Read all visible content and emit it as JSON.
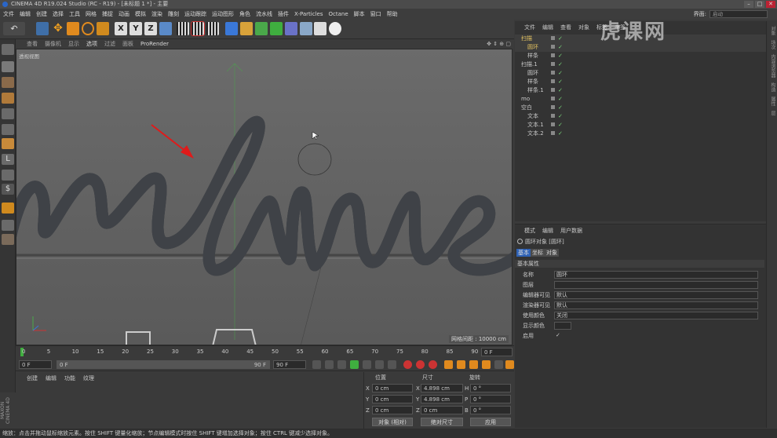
{
  "app": {
    "title": "CINEMA 4D R19.024 Studio (RC - R19) - [未标题 1 *] - 主要"
  },
  "menubar": {
    "items": [
      "文件",
      "编辑",
      "创建",
      "选择",
      "工具",
      "网格",
      "捕捉",
      "动画",
      "模拟",
      "渲染",
      "雕刻",
      "运动跟踪",
      "运动图形",
      "角色",
      "流水线",
      "插件",
      "X-Particles",
      "Octane",
      "脚本",
      "窗口",
      "帮助"
    ],
    "layout_label": "界面:",
    "layout_value": "启动"
  },
  "viewport": {
    "menu": [
      "查看",
      "摄像机",
      "显示",
      "选项",
      "过滤",
      "面板",
      "ProRender"
    ],
    "label": "透视视图",
    "grid_info": "网格间距 : 10000 cm"
  },
  "timeline": {
    "ticks": [
      "0",
      "5",
      "10",
      "15",
      "20",
      "25",
      "30",
      "35",
      "40",
      "45",
      "50",
      "55",
      "60",
      "65",
      "70",
      "75",
      "80",
      "85",
      "90"
    ],
    "end_field": "0 F"
  },
  "transport": {
    "start": "0 F",
    "range_start": "0 F",
    "range_end": "90 F",
    "end": "90 F"
  },
  "material_manager": {
    "menu": [
      "创建",
      "编辑",
      "功能",
      "纹理"
    ]
  },
  "coord_manager": {
    "headers": [
      "位置",
      "尺寸",
      "旋转"
    ],
    "rows": [
      {
        "axis": "X",
        "pos": "0 cm",
        "size_axis": "X",
        "size": "4.898 cm",
        "rot_axis": "H",
        "rot": "0 °"
      },
      {
        "axis": "Y",
        "pos": "0 cm",
        "size_axis": "Y",
        "size": "4.898 cm",
        "rot_axis": "P",
        "rot": "0 °"
      },
      {
        "axis": "Z",
        "pos": "0 cm",
        "size_axis": "Z",
        "size": "0 cm",
        "rot_axis": "B",
        "rot": "0 °"
      }
    ],
    "mode": "对象 (相对)",
    "size_mode": "绝对尺寸",
    "apply": "应用"
  },
  "object_manager": {
    "menu": [
      "文件",
      "编辑",
      "查看",
      "对象",
      "标签",
      "书签"
    ],
    "objects": [
      {
        "name": "扫描",
        "indent": 0,
        "color": "#e0c060"
      },
      {
        "name": "圆环",
        "indent": 1,
        "color": "#e0c060"
      },
      {
        "name": "样条",
        "indent": 1,
        "color": "#c8c8c8"
      },
      {
        "name": "扫描.1",
        "indent": 0,
        "color": "#c8c8c8"
      },
      {
        "name": "圆环",
        "indent": 1,
        "color": "#c8c8c8"
      },
      {
        "name": "样条",
        "indent": 1,
        "color": "#c8c8c8"
      },
      {
        "name": "样条.1",
        "indent": 1,
        "color": "#c8c8c8"
      },
      {
        "name": "mo",
        "indent": 0,
        "color": "#c8c8c8"
      },
      {
        "name": "空白",
        "indent": 0,
        "color": "#c8c8c8"
      },
      {
        "name": "文本",
        "indent": 1,
        "color": "#c8c8c8"
      },
      {
        "name": "文本.1",
        "indent": 1,
        "color": "#c8c8c8"
      },
      {
        "name": "文本.2",
        "indent": 1,
        "color": "#c8c8c8"
      }
    ]
  },
  "attribute_manager": {
    "menu": [
      "模式",
      "编辑",
      "用户数据"
    ],
    "object_title": "圆环对象 [圆环]",
    "tabs": [
      "基本",
      "坐标",
      "对象"
    ],
    "section": "基本属性",
    "rows": [
      {
        "label": "名称",
        "value": "圆环"
      },
      {
        "label": "图层",
        "value": ""
      },
      {
        "label": "编辑器可见",
        "value": "默认"
      },
      {
        "label": "渲染器可见",
        "value": "默认"
      },
      {
        "label": "使用颜色",
        "value": "关闭"
      },
      {
        "label": "显示颜色",
        "value": ""
      },
      {
        "label": "启用",
        "value": "✓"
      }
    ]
  },
  "right_strip": [
    "对象",
    "场次",
    "内容浏览器",
    "构造",
    "属性",
    "层"
  ],
  "status": "缩放：点击并拖动鼠标缩放元素。按住 SHIFT 键量化缩放；节点编辑模式时按住 SHIFT 键增加选择对象；按住 CTRL 键减少选择对象。",
  "watermark": "虎课网",
  "brand": "MAXON CINEMA 4D"
}
